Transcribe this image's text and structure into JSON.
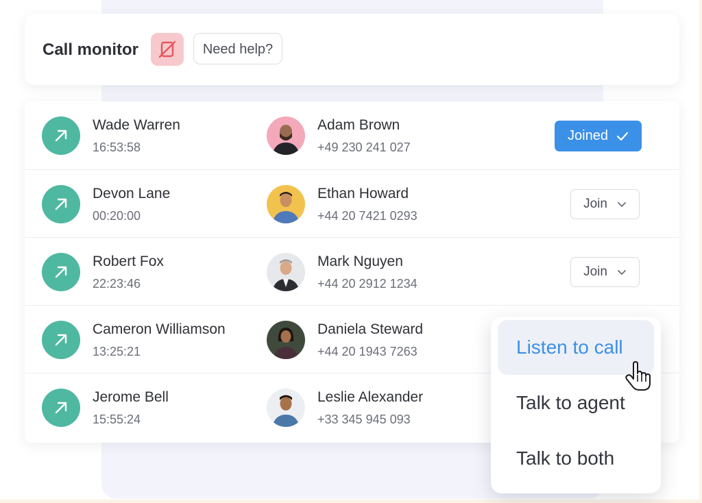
{
  "header": {
    "title": "Call monitor",
    "mute_icon": "phone-off-icon",
    "help_label": "Need help?"
  },
  "colors": {
    "accent": "#3b90e8",
    "call_icon": "#4fb8a0",
    "mute_bg": "#f7c9cc",
    "mute_icon": "#e4575f"
  },
  "calls": [
    {
      "agent": "Wade Warren",
      "duration": "16:53:58",
      "customer": "Adam Brown",
      "phone": "+49 230 241 027",
      "action": "Joined",
      "action_icon": "check-icon"
    },
    {
      "agent": "Devon Lane",
      "duration": "00:20:00",
      "customer": "Ethan Howard",
      "phone": "+44 20 7421 0293",
      "action": "Join",
      "action_icon": "chevron-down-icon"
    },
    {
      "agent": "Robert Fox",
      "duration": "22:23:46",
      "customer": "Mark Nguyen",
      "phone": "+44 20 2912 1234",
      "action": "Join",
      "action_icon": "chevron-down-icon"
    },
    {
      "agent": "Cameron Williamson",
      "duration": "13:25:21",
      "customer": "Daniela Steward",
      "phone": "+44 20 1943 7263"
    },
    {
      "agent": "Jerome Bell",
      "duration": "15:55:24",
      "customer": "Leslie Alexander",
      "phone": "+33 345 945 093"
    }
  ],
  "join_menu": {
    "items": [
      "Listen to call",
      "Talk to agent",
      "Talk to both"
    ],
    "active_index": 0
  }
}
